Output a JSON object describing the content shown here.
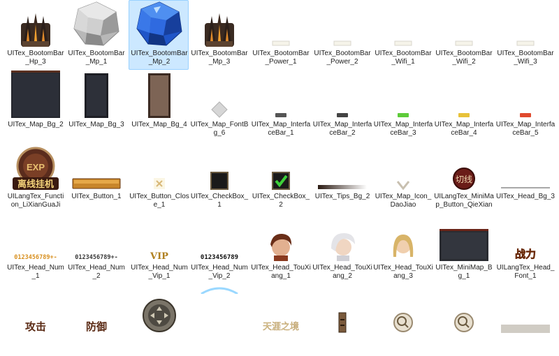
{
  "files": [
    {
      "name": "UITex_BootomBar_Hp_3",
      "icon": "spiked-gauntlet-icon"
    },
    {
      "name": "UITex_BootomBar_Mp_1",
      "icon": "silver-gem-icon"
    },
    {
      "name": "UITex_BootomBar_Mp_2",
      "icon": "blue-gem-icon",
      "selected": true
    },
    {
      "name": "UITex_BootomBar_Mp_3",
      "icon": "spiked-gauntlet-icon"
    },
    {
      "name": "UITex_BootomBar_Power_1",
      "icon": "small-bar-icon"
    },
    {
      "name": "UITex_BootomBar_Power_2",
      "icon": "small-bar-icon"
    },
    {
      "name": "UITex_BootomBar_Wifi_1",
      "icon": "small-bar-icon"
    },
    {
      "name": "UITex_BootomBar_Wifi_2",
      "icon": "small-bar-icon"
    },
    {
      "name": "UITex_BootomBar_Wifi_3",
      "icon": "small-bar-icon"
    },
    {
      "name": "UITex_Map_Bg_2",
      "icon": "map-panel-dark-icon"
    },
    {
      "name": "UITex_Map_Bg_3",
      "icon": "map-panel-narrow-icon"
    },
    {
      "name": "UITex_Map_Bg_4",
      "icon": "map-panel-brown-icon"
    },
    {
      "name": "UITex_Map_FontBg_6",
      "icon": "diamond-icon"
    },
    {
      "name": "UITex_Map_InterfaceBar_1",
      "icon": "bar-dark-icon",
      "color": "#555555"
    },
    {
      "name": "UITex_Map_InterfaceBar_2",
      "icon": "bar-dark-icon",
      "color": "#444444"
    },
    {
      "name": "UITex_Map_InterfaceBar_3",
      "icon": "bar-green-icon",
      "color": "#5ecb3a"
    },
    {
      "name": "UITex_Map_InterfaceBar_4",
      "icon": "bar-yellow-icon",
      "color": "#e8c23a"
    },
    {
      "name": "UITex_Map_InterfaceBar_5",
      "icon": "bar-red-icon",
      "color": "#e04a2e"
    },
    {
      "name": "UILangTex_Function_LiXianGuaJi",
      "icon": "offline-hangup-emblem-icon",
      "glyph": "离线挂机"
    },
    {
      "name": "UITex_Button_1",
      "icon": "gold-button-bar-icon"
    },
    {
      "name": "UITex_Button_Close_1",
      "icon": "close-x-icon"
    },
    {
      "name": "UITex_CheckBox_1",
      "icon": "checkbox-empty-icon"
    },
    {
      "name": "UITex_CheckBox_2",
      "icon": "checkbox-checked-icon"
    },
    {
      "name": "UITex_Tips_Bg_2",
      "icon": "gradient-bar-icon"
    },
    {
      "name": "UITex_Map_Icon_DaoJiao",
      "icon": "chevron-down-icon"
    },
    {
      "name": "UILangTex_MiniMap_Button_QieXian",
      "icon": "switch-line-button-icon",
      "glyph": "切线"
    },
    {
      "name": "UITex_Head_Bg_3",
      "icon": "thin-line-icon"
    },
    {
      "name": "UITex_Head_Num_1",
      "icon": "digit-strip-gold-icon",
      "glyph": "0123456789+-"
    },
    {
      "name": "UITex_Head_Num_2",
      "icon": "digit-strip-dark-icon",
      "glyph": "0123456789+-"
    },
    {
      "name": "UITex_Head_Num_Vip_1",
      "icon": "vip-label-icon",
      "glyph": "VIP"
    },
    {
      "name": "UITex_Head_Num_Vip_2",
      "icon": "digit-strip-black-icon",
      "glyph": "0123456789"
    },
    {
      "name": "UITex_Head_TouXiang_1",
      "icon": "portrait-brown-hair-icon"
    },
    {
      "name": "UITex_Head_TouXiang_2",
      "icon": "portrait-white-hair-icon"
    },
    {
      "name": "UITex_Head_TouXiang_3",
      "icon": "portrait-blonde-icon"
    },
    {
      "name": "UITex_MiniMap_Bg_1",
      "icon": "minimap-panel-icon"
    },
    {
      "name": "UILangTex_Head_Font_1",
      "icon": "combat-power-text-icon",
      "glyph": "战力"
    },
    {
      "name": "",
      "icon": "attack-text-icon",
      "glyph": "攻击"
    },
    {
      "name": "",
      "icon": "defense-text-icon",
      "glyph": "防御"
    },
    {
      "name": "",
      "icon": "joystick-icon"
    },
    {
      "name": "",
      "icon": "arc-glow-icon"
    },
    {
      "name": "",
      "icon": "calligraphy-title-icon",
      "glyph": "天涯之境"
    },
    {
      "name": "",
      "icon": "brown-slider-icon"
    },
    {
      "name": "",
      "icon": "zoom-in-icon"
    },
    {
      "name": "",
      "icon": "zoom-out-icon"
    },
    {
      "name": "",
      "icon": "panel-strip-icon"
    }
  ]
}
